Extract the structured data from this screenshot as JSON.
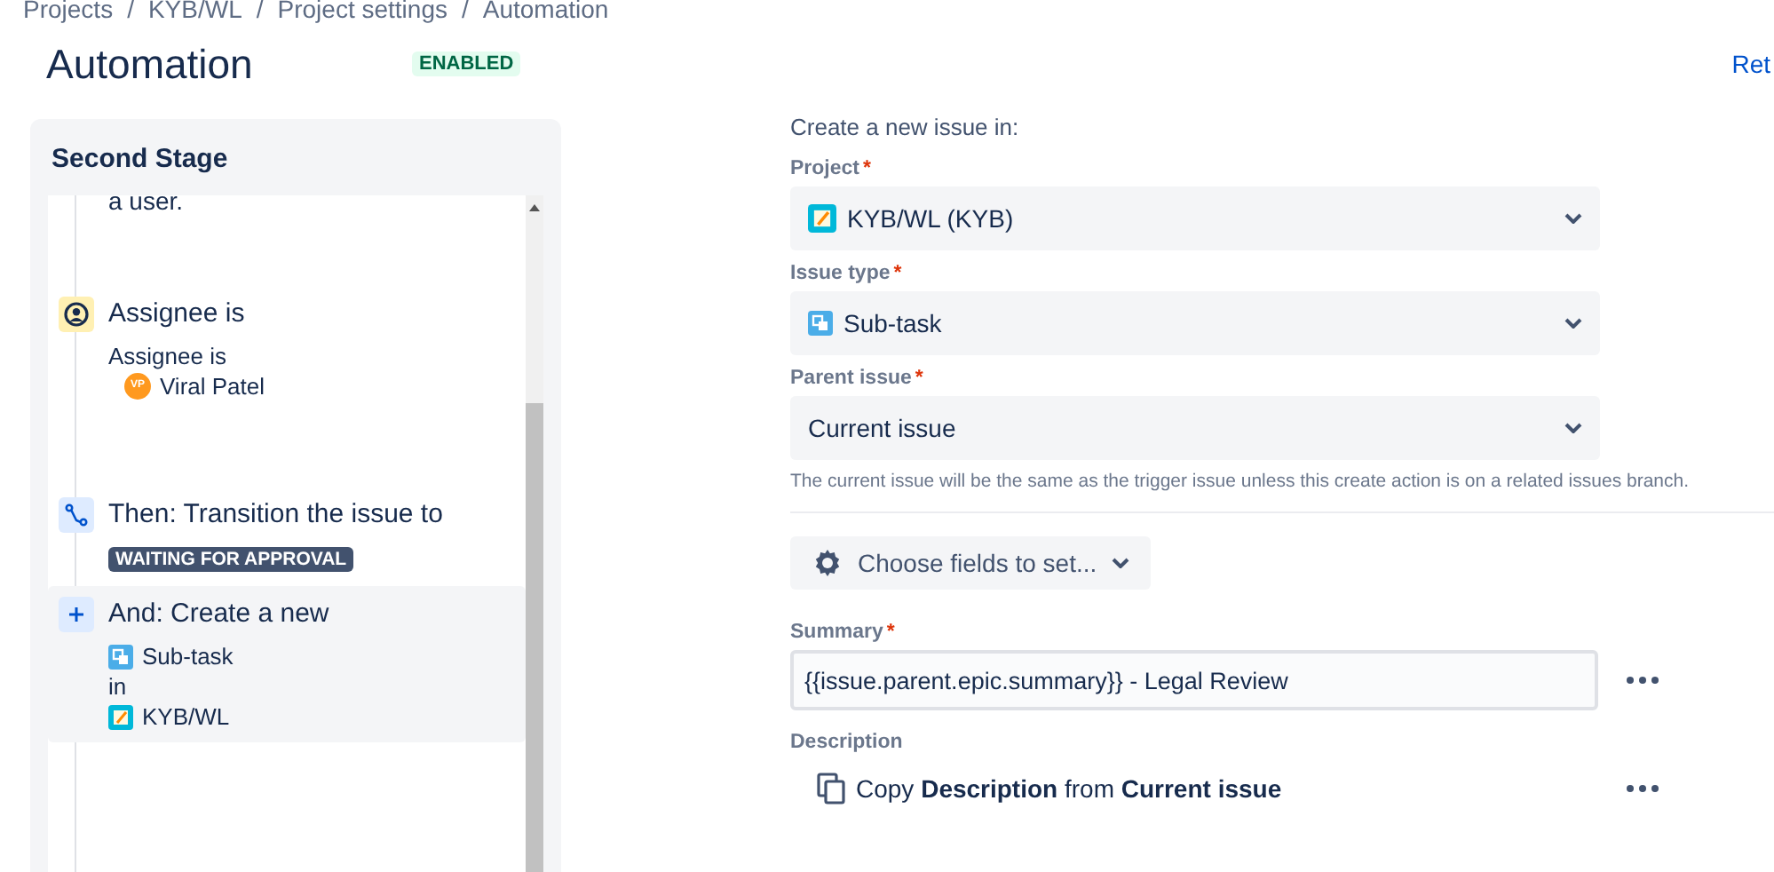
{
  "breadcrumbs": [
    "Projects",
    "KYB/WL",
    "Project settings",
    "Automation"
  ],
  "breadcrumb_separator": "/",
  "header": {
    "title": "Automation",
    "status": "ENABLED",
    "link": "Ret"
  },
  "rule_panel": {
    "title": "Second Stage",
    "cut_text": "a user.",
    "components": [
      {
        "kind": "condition",
        "title": "Assignee is",
        "selected": false,
        "lines": [
          {
            "kind": "text",
            "text": "Assignee is"
          },
          {
            "kind": "user",
            "text": "Viral Patel",
            "initials": "VP"
          }
        ]
      },
      {
        "kind": "transition",
        "title": "Then: Transition the issue to",
        "selected": false,
        "lines": [
          {
            "kind": "status",
            "text": "WAITING FOR APPROVAL"
          }
        ]
      },
      {
        "kind": "create",
        "title": "And: Create a new",
        "selected": true,
        "lines": [
          {
            "kind": "subtask",
            "text": "Sub-task"
          },
          {
            "kind": "text",
            "text": "in"
          },
          {
            "kind": "project",
            "text": "KYB/WL"
          }
        ]
      }
    ]
  },
  "form": {
    "heading": "Create a new issue in:",
    "selects": [
      {
        "label": "Project",
        "required_mark": "*",
        "value": "KYB/WL (KYB)"
      },
      {
        "label": "Issue type",
        "required_mark": "*",
        "value": "Sub-task"
      },
      {
        "label": "Parent issue",
        "required_mark": "*",
        "value": "Current issue"
      }
    ],
    "helper": "The current issue will be the same as the trigger issue unless this create action is on a related issues branch.",
    "choose_button": "Choose fields to set...",
    "summary": {
      "label": "Summary",
      "required_mark": "*",
      "value": "{{issue.parent.epic.summary}} - Legal Review"
    },
    "description": {
      "label": "Description",
      "text": "Copy **Description** from **Current issue**"
    }
  }
}
